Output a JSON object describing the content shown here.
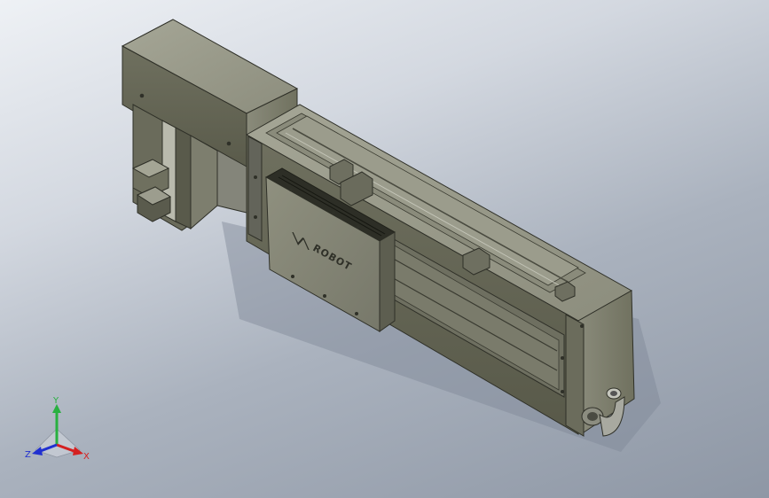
{
  "viewport": {
    "background_top": "#eef1f5",
    "background_bottom": "#8e97a5"
  },
  "model": {
    "logo_text": "ROBOT",
    "body_color": "#7b7c6d",
    "shadow_color": "#3e3f36",
    "highlight_color": "#c9cabf"
  },
  "triad": {
    "x_label": "X",
    "y_label": "Y",
    "z_label": "Z",
    "x_color": "#d42020",
    "y_color": "#28b040",
    "z_color": "#2030d0"
  }
}
